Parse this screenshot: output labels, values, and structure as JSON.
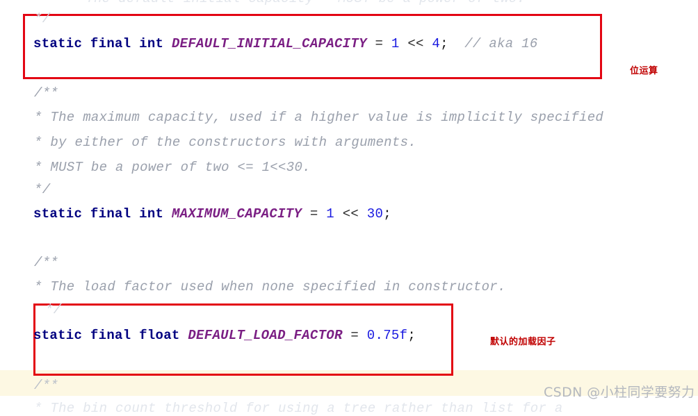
{
  "document": {
    "kind": "java-source-screenshot",
    "source_class": "HashMap",
    "watermark": "CSDN @小柱同学要努力"
  },
  "lines": [
    {
      "id": "l0",
      "role": "javadoc-truncated-top",
      "text": "* The default initial capacity - MUST be a power of two."
    },
    {
      "id": "l1",
      "role": "javadoc-close",
      "text": "*/"
    },
    {
      "id": "l2",
      "role": "field-declaration",
      "keywords": "static final int",
      "name": "DEFAULT_INITIAL_CAPACITY",
      "equals": "=",
      "value_a": "1",
      "shift": "<<",
      "value_b": "4",
      "semicolon": ";",
      "trailing_comment": "// aka 16"
    },
    {
      "id": "l3",
      "role": "javadoc-open",
      "text": "/**"
    },
    {
      "id": "l4",
      "role": "javadoc-body",
      "text": "* The maximum capacity, used if a higher value is implicitly specified"
    },
    {
      "id": "l5",
      "role": "javadoc-body",
      "text": "* by either of the constructors with arguments."
    },
    {
      "id": "l6",
      "role": "javadoc-body",
      "text": "* MUST be a power of two <= 1<<30."
    },
    {
      "id": "l7",
      "role": "javadoc-close",
      "text": "*/"
    },
    {
      "id": "l8",
      "role": "field-declaration",
      "keywords": "static final int",
      "name": "MAXIMUM_CAPACITY",
      "equals": "=",
      "value_a": "1",
      "shift": "<<",
      "value_b": "30",
      "semicolon": ";",
      "trailing_comment": ""
    },
    {
      "id": "l9",
      "role": "javadoc-open",
      "text": "/**"
    },
    {
      "id": "l10",
      "role": "javadoc-body",
      "text": "* The load factor used when none specified in constructor."
    },
    {
      "id": "l11",
      "role": "javadoc-close",
      "text": "*/"
    },
    {
      "id": "l12",
      "role": "field-declaration",
      "keywords": "static final float",
      "name": "DEFAULT_LOAD_FACTOR",
      "equals": "=",
      "value_a": "0.75f",
      "semicolon": ";"
    },
    {
      "id": "l13",
      "role": "javadoc-open",
      "text": "/**"
    },
    {
      "id": "l14",
      "role": "javadoc-body-truncated-bottom",
      "text": "* The bin count threshold for using a tree rather than list for a"
    }
  ],
  "annotations": [
    {
      "id": "a1",
      "label": "位运算",
      "target": "DEFAULT_INITIAL_CAPACITY"
    },
    {
      "id": "a2",
      "label": "默认的加载因子",
      "target": "DEFAULT_LOAD_FACTOR"
    }
  ],
  "highlight_boxes": [
    {
      "id": "box1",
      "target": "DEFAULT_INITIAL_CAPACITY"
    },
    {
      "id": "box2",
      "target": "DEFAULT_LOAD_FACTOR"
    }
  ],
  "colors": {
    "box_stroke": "#e30613",
    "annotation_text": "#c00000",
    "keyword": "#000080",
    "constant": "#7b1f84",
    "number": "#1a1ae0",
    "comment": "#9aa0ac",
    "cream_band": "#fdf8e3",
    "watermark": "#b4b8bf",
    "page_background": "#ffffff"
  }
}
